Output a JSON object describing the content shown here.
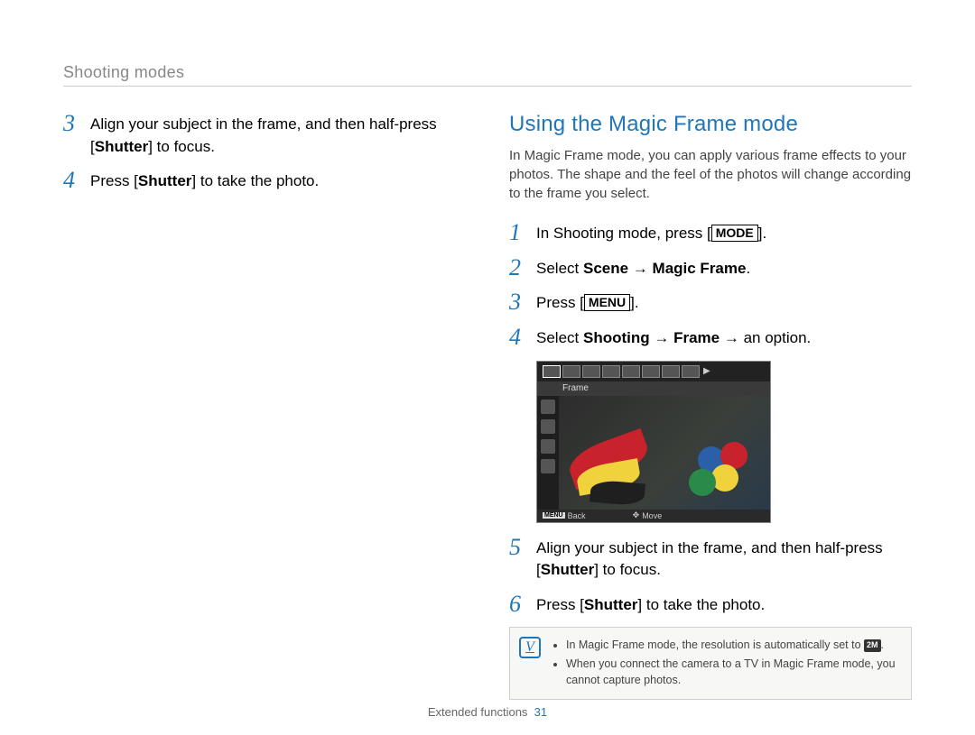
{
  "section_label": "Shooting modes",
  "left": {
    "steps": [
      {
        "num": "3",
        "parts": [
          "Align your subject in the frame, and then half-press [",
          {
            "bold": true,
            "t": "Shutter"
          },
          "] to focus."
        ]
      },
      {
        "num": "4",
        "parts": [
          "Press [",
          {
            "bold": true,
            "t": "Shutter"
          },
          "] to take the photo."
        ]
      }
    ]
  },
  "right": {
    "heading": "Using the Magic Frame mode",
    "intro": "In Magic Frame mode, you can apply various frame effects to your photos. The shape and the feel of the photos will change according to the frame you select.",
    "steps_a": [
      {
        "num": "1",
        "parts": [
          "In Shooting mode, press [",
          {
            "btn": true,
            "t": "MODE"
          },
          "]."
        ]
      },
      {
        "num": "2",
        "parts": [
          "Select ",
          {
            "bold": true,
            "t": "Scene"
          },
          " → ",
          {
            "bold": true,
            "t": "Magic Frame"
          },
          "."
        ]
      },
      {
        "num": "3",
        "parts": [
          "Press [",
          {
            "btn": true,
            "t": "MENU"
          },
          "]."
        ]
      },
      {
        "num": "4",
        "parts": [
          "Select ",
          {
            "bold": true,
            "t": "Shooting"
          },
          " → ",
          {
            "bold": true,
            "t": "Frame"
          },
          " → an option."
        ]
      }
    ],
    "screenshot": {
      "frame_label": "Frame",
      "back_tag": "MENU",
      "back_label": "Back",
      "move_label": "Move"
    },
    "steps_b": [
      {
        "num": "5",
        "parts": [
          "Align your subject in the frame, and then half-press [",
          {
            "bold": true,
            "t": "Shutter"
          },
          "] to focus."
        ]
      },
      {
        "num": "6",
        "parts": [
          "Press [",
          {
            "bold": true,
            "t": "Shutter"
          },
          "] to take the photo."
        ]
      }
    ],
    "notes": [
      {
        "parts": [
          "In Magic Frame mode, the resolution is automatically set to ",
          {
            "chip": true,
            "t": "2M"
          },
          "."
        ]
      },
      {
        "parts": [
          "When you connect the camera to a TV in Magic Frame mode, you cannot capture photos."
        ]
      }
    ]
  },
  "footer": {
    "label": "Extended functions",
    "page": "31"
  }
}
